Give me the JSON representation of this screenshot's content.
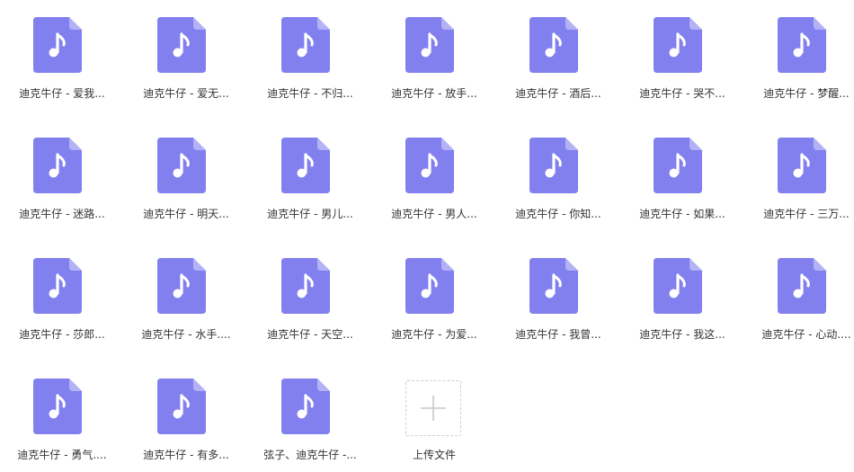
{
  "colors": {
    "file_icon_body": "#8180ee",
    "file_icon_fold": "#b3b2f6",
    "upload_border": "#cfcfd6",
    "upload_plus": "#c7c7cf"
  },
  "files": [
    {
      "name": "迪克牛仔 - 爱我...",
      "icon": "music-file-icon"
    },
    {
      "name": "迪克牛仔 - 爱无...",
      "icon": "music-file-icon"
    },
    {
      "name": "迪克牛仔 - 不归...",
      "icon": "music-file-icon"
    },
    {
      "name": "迪克牛仔 - 放手...",
      "icon": "music-file-icon"
    },
    {
      "name": "迪克牛仔 - 酒后...",
      "icon": "music-file-icon"
    },
    {
      "name": "迪克牛仔 - 哭不...",
      "icon": "music-file-icon"
    },
    {
      "name": "迪克牛仔 - 梦醒...",
      "icon": "music-file-icon"
    },
    {
      "name": "迪克牛仔 - 迷路...",
      "icon": "music-file-icon"
    },
    {
      "name": "迪克牛仔 - 明天...",
      "icon": "music-file-icon"
    },
    {
      "name": "迪克牛仔 - 男儿...",
      "icon": "music-file-icon"
    },
    {
      "name": "迪克牛仔 - 男人...",
      "icon": "music-file-icon"
    },
    {
      "name": "迪克牛仔 - 你知...",
      "icon": "music-file-icon"
    },
    {
      "name": "迪克牛仔 - 如果...",
      "icon": "music-file-icon"
    },
    {
      "name": "迪克牛仔 - 三万...",
      "icon": "music-file-icon"
    },
    {
      "name": "迪克牛仔 - 莎郎...",
      "icon": "music-file-icon"
    },
    {
      "name": "迪克牛仔 - 水手....",
      "icon": "music-file-icon"
    },
    {
      "name": "迪克牛仔 - 天空...",
      "icon": "music-file-icon"
    },
    {
      "name": "迪克牛仔 - 为爱...",
      "icon": "music-file-icon"
    },
    {
      "name": "迪克牛仔 - 我曾...",
      "icon": "music-file-icon"
    },
    {
      "name": "迪克牛仔 - 我这...",
      "icon": "music-file-icon"
    },
    {
      "name": "迪克牛仔 - 心动....",
      "icon": "music-file-icon"
    },
    {
      "name": "迪克牛仔 - 勇气....",
      "icon": "music-file-icon"
    },
    {
      "name": "迪克牛仔 - 有多...",
      "icon": "music-file-icon"
    },
    {
      "name": "弦子、迪克牛仔 -...",
      "icon": "music-file-icon"
    }
  ],
  "upload": {
    "label": "上传文件",
    "icon": "plus-icon"
  }
}
